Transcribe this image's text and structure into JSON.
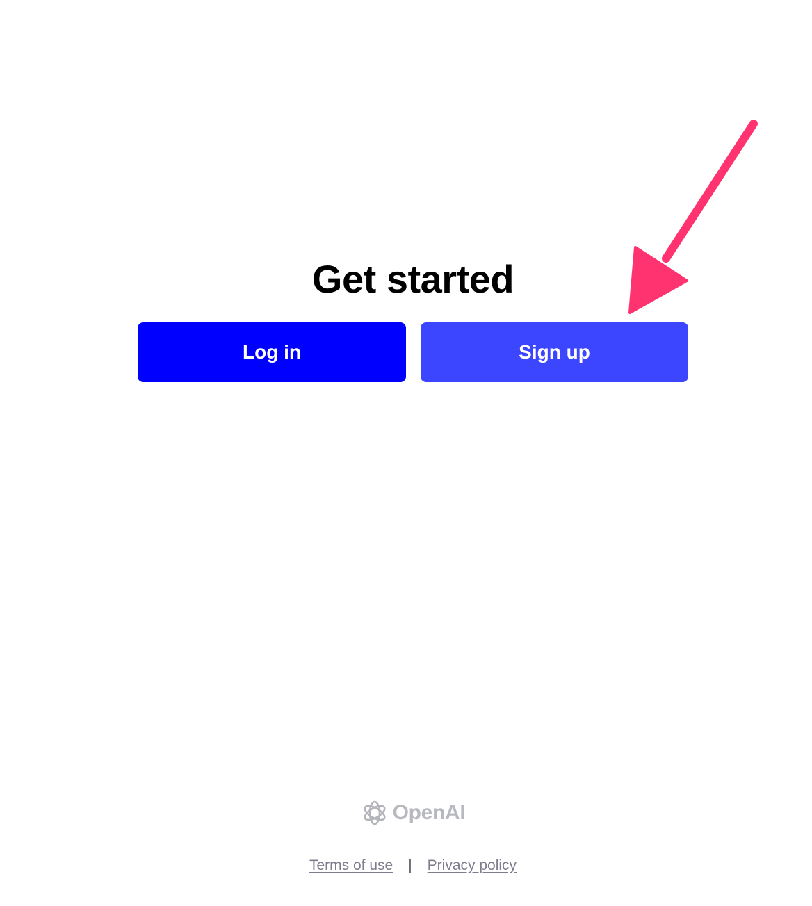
{
  "main": {
    "title": "Get started",
    "login_label": "Log in",
    "signup_label": "Sign up"
  },
  "brand": {
    "name": "OpenAI",
    "icon": "openai-logo-icon"
  },
  "footer": {
    "terms_label": "Terms of use",
    "separator": "|",
    "privacy_label": "Privacy policy"
  },
  "annotation": {
    "icon": "pointer-arrow-icon",
    "color": "#ff3370"
  },
  "colors": {
    "login_button": "#0000ff",
    "signup_button": "#3d46ff",
    "title_text": "#000000",
    "footer_link": "#7d7d8e"
  }
}
